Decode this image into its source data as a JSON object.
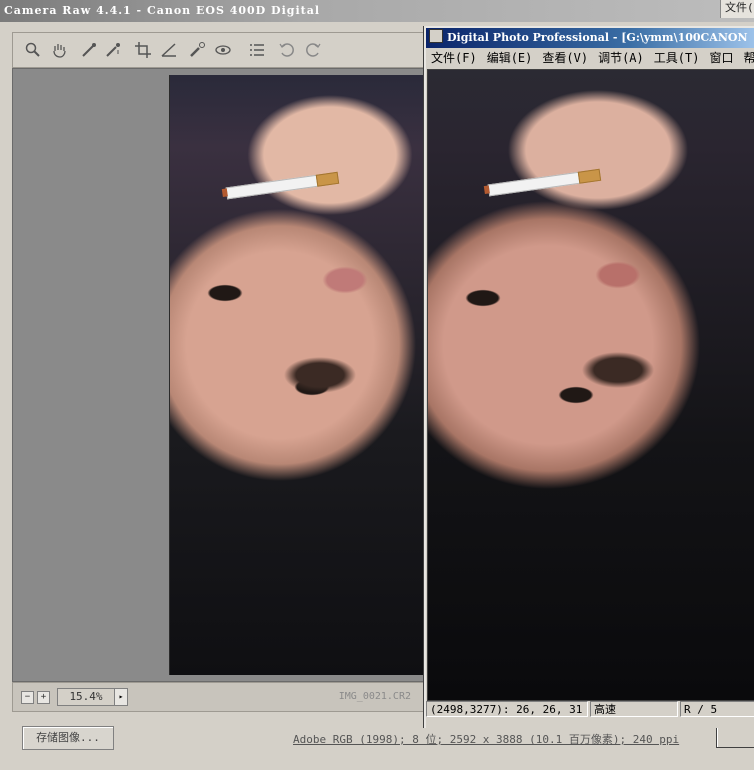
{
  "camera_raw": {
    "title": "Camera Raw 4.4.1 -  Canon EOS 400D Digital",
    "tools": [
      "zoom-icon",
      "hand-icon",
      "white-balance-icon",
      "color-sampler-icon",
      "crop-icon",
      "straighten-icon",
      "retouch-icon",
      "red-eye-icon",
      "preferences-icon",
      "rotate-left-icon",
      "rotate-right-icon"
    ],
    "zoom_value": "15.4%",
    "zoom_out_label": "−",
    "zoom_in_label": "+",
    "zoom_menu_label": "▸",
    "filename": "IMG_0021.CR2",
    "save_label": "存储图像...",
    "workflow_info": "Adobe RGB (1998); 8 位; 2592 x 3888 (10.1 百万像素); 240 ppi"
  },
  "background_menu": {
    "label": "文件("
  },
  "dpp": {
    "title": "Digital Photo Professional - [G:\\ymm\\100CANON",
    "menu": [
      "文件(F)",
      "编辑(E)",
      "查看(V)",
      "调节(A)",
      "工具(T)",
      "窗口",
      "帮助"
    ],
    "status": {
      "pixel_info": "(2498,3277): 26, 26, 31",
      "quality": "高速",
      "rating": "R / 5"
    }
  }
}
